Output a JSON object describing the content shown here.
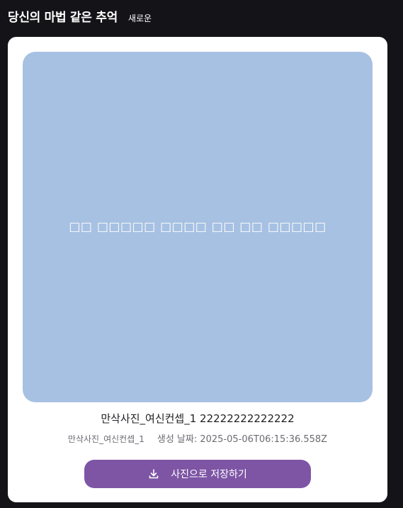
{
  "header": {
    "title": "당신의 마법 같은 추억",
    "badge": "새로운"
  },
  "photo": {
    "overlay_text": "□□ □□□□□ □□□□ □□ □□ □□□□□",
    "background_color": "#a7c1e2"
  },
  "details": {
    "name": "만삭사진_여신컨셉_1 22222222222222",
    "concept": "만삭사진_여신컨셉_1",
    "created_at": "생성 날짜: 2025-05-06T06:15:36.558Z"
  },
  "save_button": {
    "label": "사진으로 저장하기",
    "icon": "download-icon",
    "color": "#7e55a5"
  }
}
